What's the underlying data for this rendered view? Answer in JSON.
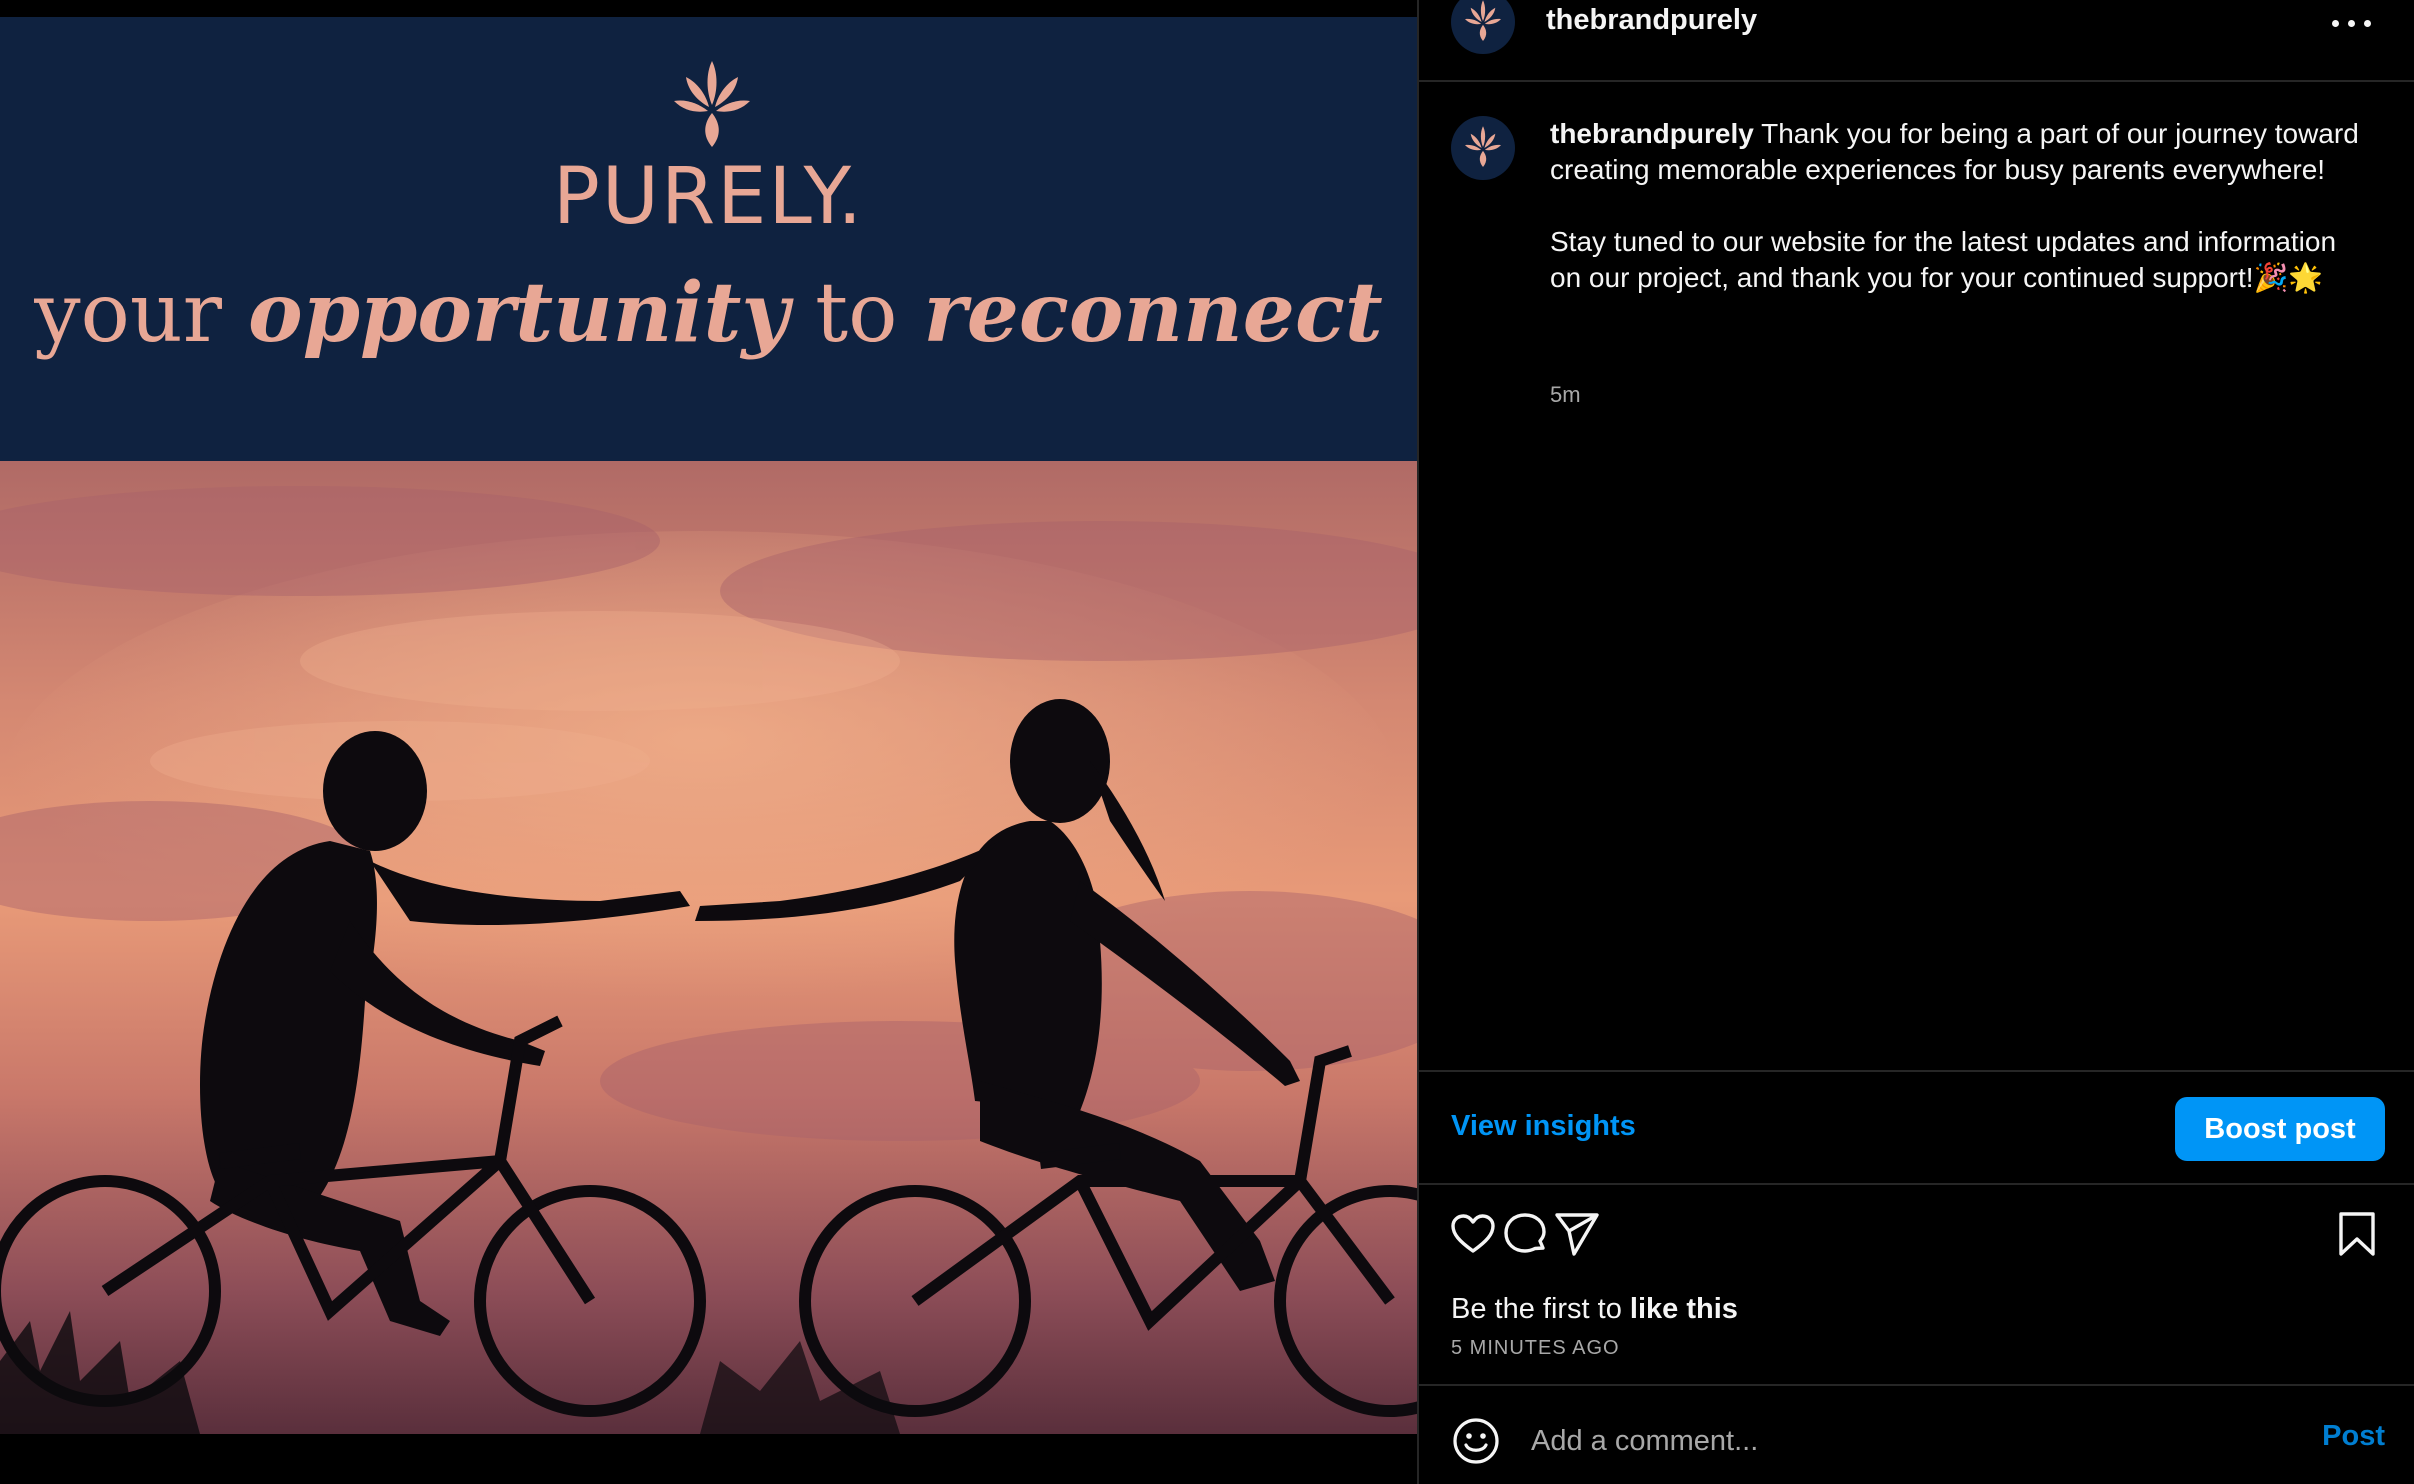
{
  "colors": {
    "banner_bg": "#0f2240",
    "brand_accent": "#e8a795",
    "link_blue": "#0095f6",
    "muted_text": "#a8a8a8",
    "border": "#262626"
  },
  "media": {
    "brand_name": "PURELY.",
    "tagline": {
      "w1": "your",
      "w2": "opportunity",
      "w3": "to",
      "w4": "reconnect"
    },
    "photo_description_icon": "couple-cycling-sunset-photo"
  },
  "header": {
    "username": "thebrandpurely",
    "more_icon": "more-options-icon"
  },
  "caption": {
    "username": "thebrandpurely",
    "paragraph1": "Thank you for being a part of our journey toward creating memorable experiences for busy parents everywhere!",
    "paragraph2": "Stay tuned to our website for the latest updates and information on our project, and thank you for your continued support!🎉🌟",
    "time": "5m"
  },
  "insights": {
    "view_label": "View insights",
    "boost_label": "Boost post"
  },
  "actions": {
    "icons": [
      "heart-icon",
      "comment-icon",
      "share-icon",
      "bookmark-icon"
    ],
    "likes_prefix": "Be the first to ",
    "likes_bold": "like this",
    "age": "5 MINUTES AGO"
  },
  "comment": {
    "placeholder": "Add a comment...",
    "post_label": "Post",
    "emoji_icon": "emoji-icon"
  }
}
